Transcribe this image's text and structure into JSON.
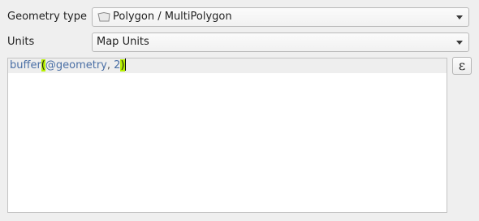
{
  "geometry_type": {
    "label": "Geometry type",
    "value": "Polygon / MultiPolygon",
    "icon": "polygon-geometry-icon"
  },
  "units": {
    "label": "Units",
    "value": "Map Units"
  },
  "expression": {
    "function": "buffer",
    "open_paren": "(",
    "variable": "@geometry",
    "separator": ", ",
    "argument": "2",
    "close_paren": ")"
  },
  "expression_button": {
    "symbol": "ε"
  }
}
